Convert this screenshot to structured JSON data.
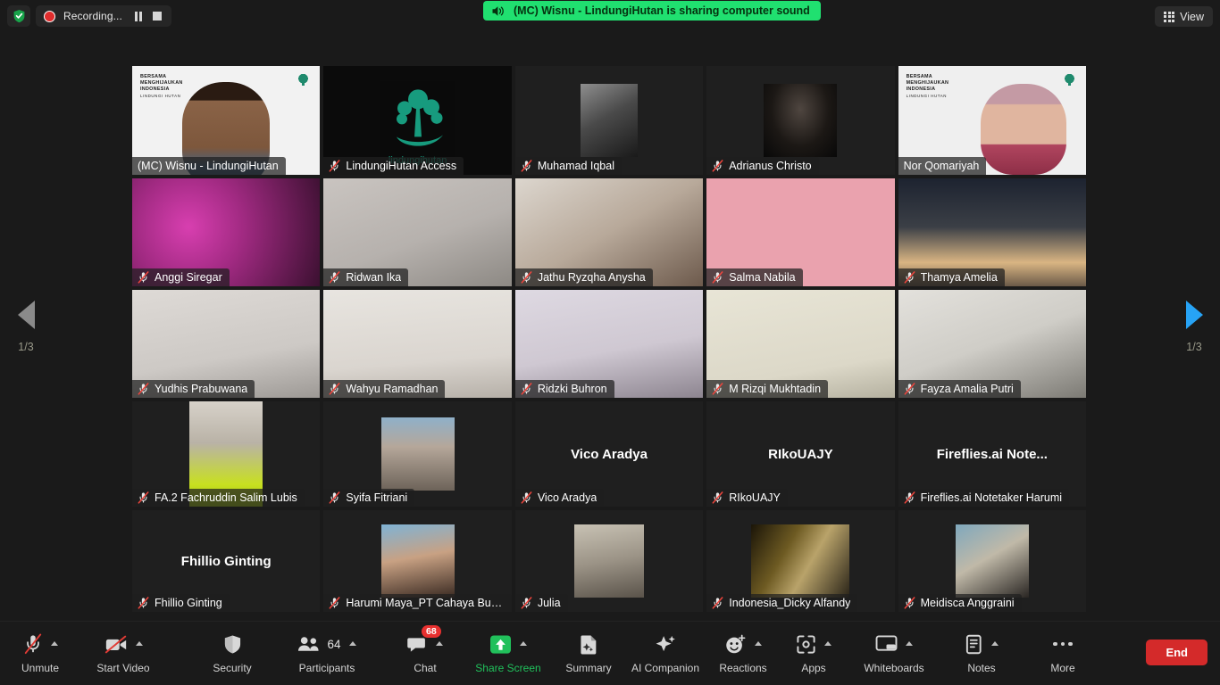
{
  "topbar": {
    "shield_icon": "shield-check-icon",
    "recording_label": "Recording...",
    "pause_icon": "pause-icon",
    "stop_icon": "stop-icon",
    "share_banner": "(MC) Wisnu - LindungiHutan is sharing computer sound",
    "speaker_icon": "speaker-icon",
    "view_label": "View",
    "view_icon": "grid-icon"
  },
  "nav": {
    "prev_icon": "chevron-left-icon",
    "next_icon": "chevron-right-icon",
    "page_left": "1/3",
    "page_right": "1/3"
  },
  "gallery": {
    "rows": [
      [
        {
          "name": "(MC) Wisnu - LindungiHutan",
          "muted": false,
          "speaking": true,
          "kind": "video",
          "center_name": null,
          "bg": "lh-slide-male"
        },
        {
          "name": "LindungiHutan Access",
          "muted": true,
          "speaking": false,
          "kind": "logo",
          "center_name": null,
          "bg": "lh-logo"
        },
        {
          "name": "Muhamad Iqbal",
          "muted": true,
          "speaking": false,
          "kind": "avatar",
          "center_name": null,
          "bg": "photo-bw-forest"
        },
        {
          "name": "Adrianus Christo",
          "muted": true,
          "speaking": false,
          "kind": "avatar",
          "center_name": null,
          "bg": "photo-dark-portrait"
        },
        {
          "name": "Nor Qomariyah",
          "muted": false,
          "speaking": false,
          "kind": "video",
          "center_name": null,
          "bg": "lh-slide-hijab"
        }
      ],
      [
        {
          "name": "Anggi Siregar",
          "muted": true,
          "speaking": false,
          "kind": "video",
          "center_name": null,
          "bg": "birthday-balloons"
        },
        {
          "name": "Ridwan Ika",
          "muted": true,
          "speaking": false,
          "kind": "video",
          "center_name": null,
          "bg": "grey-room-man"
        },
        {
          "name": "Jathu Ryzqha Anysha",
          "muted": true,
          "speaking": false,
          "kind": "video",
          "center_name": null,
          "bg": "thumbsup-woman"
        },
        {
          "name": "Salma Nabila",
          "muted": true,
          "speaking": false,
          "kind": "video",
          "center_name": null,
          "bg": "pink-wall-hijab"
        },
        {
          "name": "Thamya Amelia",
          "muted": true,
          "speaking": false,
          "kind": "video",
          "center_name": null,
          "bg": "sunset-trees"
        }
      ],
      [
        {
          "name": "Yudhis Prabuwana",
          "muted": true,
          "speaking": false,
          "kind": "video",
          "center_name": null,
          "bg": "white-wall-glasses"
        },
        {
          "name": "Wahyu Ramadhan",
          "muted": true,
          "speaking": false,
          "kind": "video",
          "center_name": null,
          "bg": "fist-up-man"
        },
        {
          "name": "Ridzki Buhron",
          "muted": true,
          "speaking": false,
          "kind": "video",
          "center_name": null,
          "bg": "peace-sign-man"
        },
        {
          "name": "M Rizqi Mukhtadin",
          "muted": true,
          "speaking": false,
          "kind": "video",
          "center_name": null,
          "bg": "cream-wall-glasses"
        },
        {
          "name": "Fayza Amalia Putri",
          "muted": true,
          "speaking": false,
          "kind": "video",
          "center_name": null,
          "bg": "plant-room-hijab"
        }
      ],
      [
        {
          "name": "FA.2 Fachruddin Salim Lubis",
          "muted": true,
          "speaking": false,
          "kind": "video",
          "center_name": null,
          "bg": "hi-vis-man"
        },
        {
          "name": "Syifa Fitriani",
          "muted": true,
          "speaking": false,
          "kind": "avatar",
          "center_name": null,
          "bg": "photo-site-hijab"
        },
        {
          "name": "Vico Aradya",
          "muted": true,
          "speaking": false,
          "kind": "name",
          "center_name": "Vico Aradya",
          "bg": null
        },
        {
          "name": "RIkoUAJY",
          "muted": true,
          "speaking": false,
          "kind": "name",
          "center_name": "RIkoUAJY",
          "bg": null
        },
        {
          "name": "Fireflies.ai Notetaker Harumi",
          "muted": true,
          "speaking": false,
          "kind": "name",
          "center_name": "Fireflies.ai  Note...",
          "bg": null
        }
      ],
      [
        {
          "name": "Fhillio Ginting",
          "muted": true,
          "speaking": false,
          "kind": "name",
          "center_name": "Fhillio Ginting",
          "bg": null
        },
        {
          "name": "Harumi Maya_PT Cahaya Bukit...",
          "muted": true,
          "speaking": false,
          "kind": "avatar",
          "center_name": null,
          "bg": "photo-glasses-woman"
        },
        {
          "name": "Julia",
          "muted": true,
          "speaking": false,
          "kind": "avatar",
          "center_name": null,
          "bg": "photo-stone-hijab"
        },
        {
          "name": "Indonesia_Dicky Alfandy",
          "muted": true,
          "speaking": false,
          "kind": "avatar",
          "center_name": null,
          "bg": "photo-spotlight-suit"
        },
        {
          "name": "Meidisca Anggraini",
          "muted": true,
          "speaking": false,
          "kind": "avatar",
          "center_name": null,
          "bg": "photo-lab-hijab"
        }
      ]
    ]
  },
  "toolbar": {
    "items": [
      {
        "label": "Unmute",
        "icon": "mic-muted-icon",
        "caret": true,
        "green": false
      },
      {
        "label": "Start Video",
        "icon": "video-off-icon",
        "caret": true,
        "green": false
      },
      {
        "label": "Security",
        "icon": "shield-icon",
        "caret": false,
        "green": false
      },
      {
        "label": "Participants",
        "icon": "participants-icon",
        "caret": true,
        "green": false,
        "count": "64"
      },
      {
        "label": "Chat",
        "icon": "chat-icon",
        "caret": true,
        "green": false,
        "badge": "68"
      },
      {
        "label": "Share Screen",
        "icon": "share-screen-icon",
        "caret": true,
        "green": true
      },
      {
        "label": "Summary",
        "icon": "summary-icon",
        "caret": false,
        "green": false
      },
      {
        "label": "AI Companion",
        "icon": "ai-sparkle-icon",
        "caret": false,
        "green": false
      },
      {
        "label": "Reactions",
        "icon": "reactions-icon",
        "caret": true,
        "green": false
      },
      {
        "label": "Apps",
        "icon": "apps-icon",
        "caret": true,
        "green": false
      },
      {
        "label": "Whiteboards",
        "icon": "whiteboard-icon",
        "caret": true,
        "green": false
      },
      {
        "label": "Notes",
        "icon": "notes-icon",
        "caret": true,
        "green": false
      },
      {
        "label": "More",
        "icon": "more-dots-icon",
        "caret": false,
        "green": false
      }
    ],
    "end_label": "End"
  },
  "colors": {
    "accent_green": "#20e070",
    "end_red": "#d42a2a",
    "badge_red": "#e8302f",
    "speaking_border": "#d8f24a",
    "next_arrow_blue": "#27a3f5"
  }
}
